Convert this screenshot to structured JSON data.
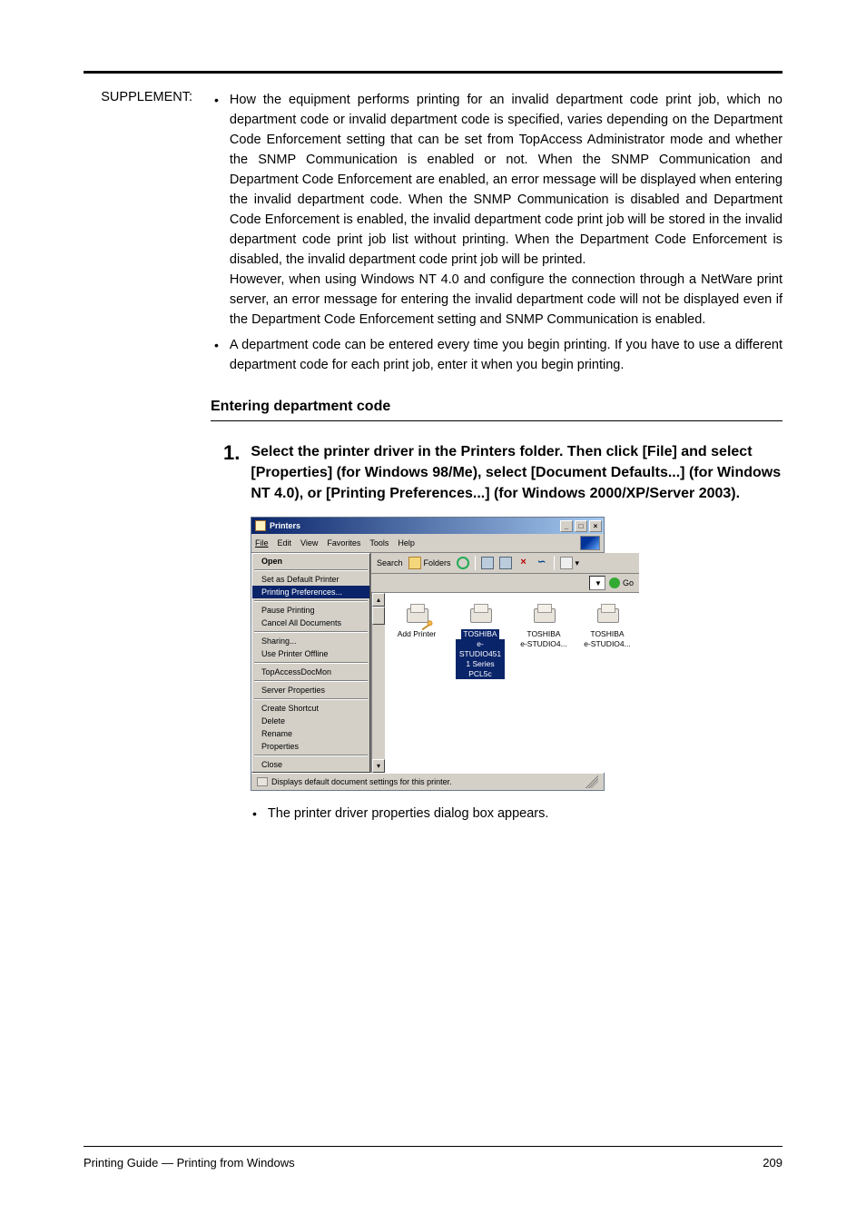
{
  "supplement_label": "SUPPLEMENT:",
  "bullets": {
    "b1p1": "How the equipment performs printing for an invalid department code print job, which no department code or invalid department code is specified, varies depending on the Department Code Enforcement setting that can be set from TopAccess Administrator mode and whether the SNMP Communication is enabled or not. When the SNMP Communication and Department Code Enforcement are enabled, an error message will be displayed when entering the invalid department code. When the SNMP Communication is disabled and Department Code Enforcement is enabled, the invalid department code print job will be stored in the invalid department code print job list without printing. When the Department Code Enforcement is disabled, the invalid department code print job will be printed.",
    "b1p2": "However, when using Windows NT 4.0 and configure the connection through a NetWare print server, an error message for entering the invalid department code will not be displayed even if the Department Code Enforcement setting and SNMP Communication is enabled.",
    "b2": "A department code can be entered every time you begin printing. If you have to use a different department code for each print job, enter it when you begin printing."
  },
  "section_title": "Entering department code",
  "step": {
    "num": "1.",
    "text": "Select the printer driver in the Printers folder. Then click [File] and select [Properties] (for Windows 98/Me), select [Document Defaults...] (for Windows NT 4.0), or [Printing Preferences...] (for Windows 2000/XP/Server 2003)."
  },
  "screenshot": {
    "title": "Printers",
    "menus": {
      "file": "File",
      "edit": "Edit",
      "view": "View",
      "favorites": "Favorites",
      "tools": "Tools",
      "help": "Help"
    },
    "file_menu": {
      "open": "Open",
      "set_default": "Set as Default Printer",
      "prefs": "Printing Preferences...",
      "pause": "Pause Printing",
      "cancel": "Cancel All Documents",
      "sharing": "Sharing...",
      "offline": "Use Printer Offline",
      "topaccess": "TopAccessDocMon",
      "server": "Server Properties",
      "shortcut": "Create Shortcut",
      "delete": "Delete",
      "rename": "Rename",
      "properties": "Properties",
      "close": "Close"
    },
    "toolbar": {
      "search": "Search",
      "folders": "Folders",
      "go": "Go"
    },
    "printers": {
      "add": "Add Printer",
      "p1a": "TOSHIBA",
      "p1b": "e-STUDIO451",
      "p1c": "1 Series PCL5c",
      "p2a": "TOSHIBA",
      "p2b": "e-STUDIO4...",
      "p3a": "TOSHIBA",
      "p3b": "e-STUDIO4..."
    },
    "status": "Displays default document settings for this printer."
  },
  "after_bullet": "The printer driver properties dialog box appears.",
  "footer": {
    "left": "Printing Guide — Printing from Windows",
    "right": "209"
  }
}
